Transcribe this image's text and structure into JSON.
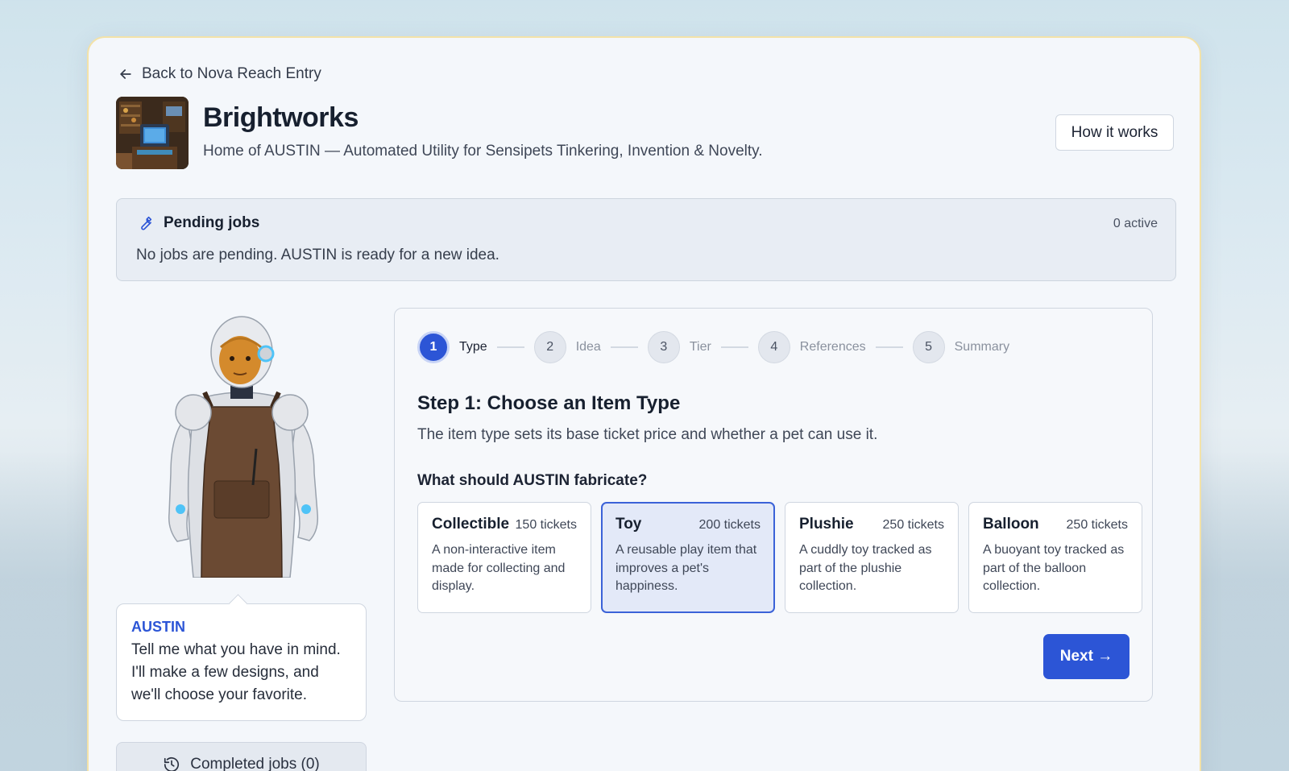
{
  "nav": {
    "back_label": "Back to Nova Reach Entry"
  },
  "header": {
    "title": "Brightworks",
    "subtitle": "Home of AUSTIN — Automated Utility for Sensipets Tinkering, Invention & Novelty.",
    "how_it_works_label": "How it works"
  },
  "pending": {
    "title": "Pending jobs",
    "count": "0 active",
    "message": "No jobs are pending. AUSTIN is ready for a new idea."
  },
  "austin": {
    "name": "AUSTIN",
    "message": "Tell me what you have in mind. I'll make a few designs, and we'll choose your favorite."
  },
  "completed": {
    "label": "Completed jobs (0)"
  },
  "wizard": {
    "steps": [
      {
        "number": "1",
        "label": "Type",
        "active": true
      },
      {
        "number": "2",
        "label": "Idea",
        "active": false
      },
      {
        "number": "3",
        "label": "Tier",
        "active": false
      },
      {
        "number": "4",
        "label": "References",
        "active": false
      },
      {
        "number": "5",
        "label": "Summary",
        "active": false
      }
    ],
    "title": "Step 1: Choose an Item Type",
    "description": "The item type sets its base ticket price and whether a pet can use it.",
    "question": "What should AUSTIN fabricate?",
    "options": [
      {
        "name": "Collectible",
        "price": "150 tickets",
        "description": "A non-interactive item made for collecting and display.",
        "selected": false
      },
      {
        "name": "Toy",
        "price": "200 tickets",
        "description": "A reusable play item that improves a pet's happiness.",
        "selected": true
      },
      {
        "name": "Plushie",
        "price": "250 tickets",
        "description": "A cuddly toy tracked as part of the plushie collection.",
        "selected": false
      },
      {
        "name": "Balloon",
        "price": "250 tickets",
        "description": "A buoyant toy tracked as part of the balloon collection.",
        "selected": false
      }
    ],
    "next_label": "Next →"
  },
  "colors": {
    "accent": "#2c55d6",
    "card_border": "#f3e2a8",
    "selected_bg": "#e3e9f8"
  }
}
